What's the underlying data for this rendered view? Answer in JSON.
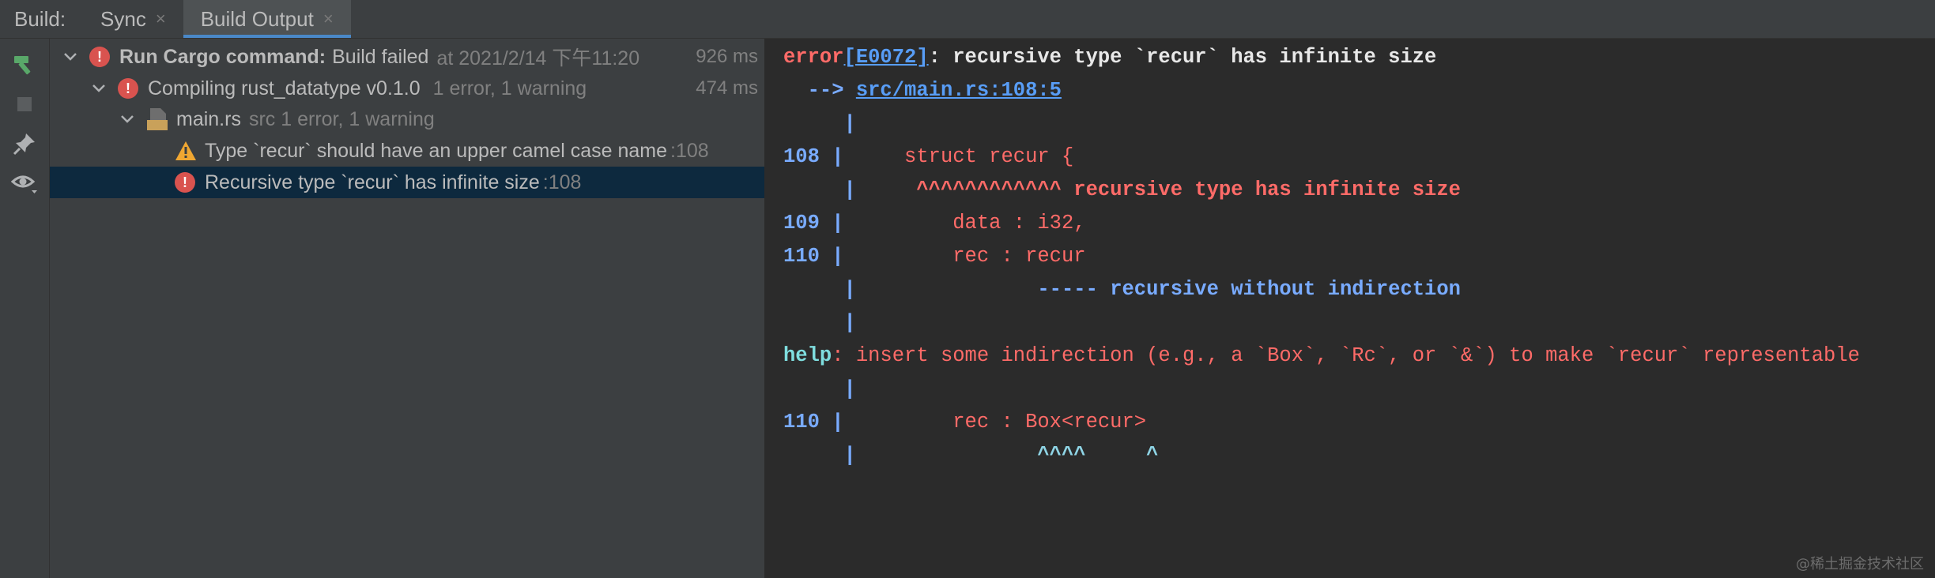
{
  "tabbar": {
    "prefix": "Build:",
    "tabs": [
      {
        "label": "Sync",
        "close": "×"
      },
      {
        "label": "Build Output",
        "close": "×"
      }
    ]
  },
  "toolbar": {
    "icons": [
      "hammer-icon",
      "stop-icon",
      "pin-icon",
      "eye-icon"
    ]
  },
  "tree": {
    "root": {
      "label": "Run Cargo command:",
      "status": "Build failed",
      "detail": "at 2021/2/14 下午11:20",
      "time": "926 ms"
    },
    "compiling": {
      "label": "Compiling rust_datatype v0.1.0",
      "detail": "1 error, 1 warning",
      "time": "474 ms"
    },
    "file": {
      "label": "main.rs",
      "detail": "src 1 error, 1 warning",
      "badge": "RS"
    },
    "warning": {
      "label": "Type `recur` should have an upper camel case name",
      "line": ":108"
    },
    "error": {
      "label": "Recursive type `recur` has infinite size",
      "line": ":108"
    }
  },
  "console": {
    "l1": {
      "error": "error",
      "code": "[E0072]",
      "msg": ": recursive type `recur` has infinite size"
    },
    "l2": {
      "arrow": "  -->",
      "path": "src/main.rs:108:5"
    },
    "l3": {
      "bar": "     |"
    },
    "l4": {
      "num": "108",
      "bar": " |",
      "code": "     struct recur {"
    },
    "l5": {
      "bar": "     |",
      "carets": "     ^^^^^^^^^^^^",
      "msg": " recursive type has infinite size"
    },
    "l6": {
      "num": "109",
      "bar": " |",
      "code": "         data : i32,"
    },
    "l7": {
      "num": "110",
      "bar": " |",
      "code": "         rec : recur"
    },
    "l8": {
      "bar": "     |",
      "dashes": "               -----",
      "msg": " recursive without indirection"
    },
    "l9": {
      "bar": "     |"
    },
    "l10": {
      "help": "help",
      "msg": ": insert some indirection (e.g., a `Box`, `Rc`, or `&`) to make `recur` representable"
    },
    "l11": {
      "bar": "     |"
    },
    "l12": {
      "num": "110",
      "bar": " |",
      "code": "         rec : Box<recur>"
    },
    "l13": {
      "bar": "     |",
      "carets": "               ^^^^     ^"
    }
  },
  "watermark": "@稀土掘金技术社区",
  "colors": {
    "error": "#ff6b68",
    "link": "#589df6",
    "accent": "#4a88c7",
    "selection": "#0d293e"
  }
}
